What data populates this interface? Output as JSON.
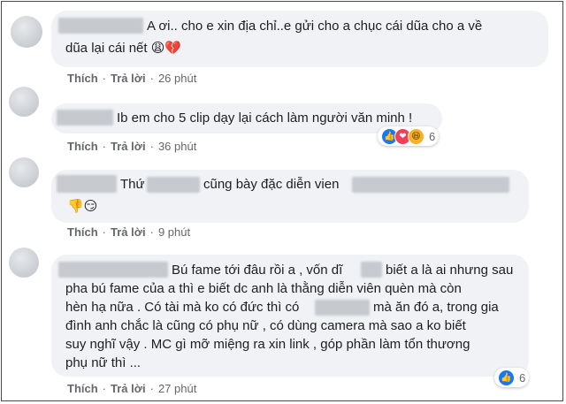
{
  "comments": [
    {
      "text": "A ơi.. cho e xin địa chỉ..e gửi cho a chục cái dũa cho a về",
      "text2": "dũa lại cái nết",
      "emoji_suffix": "😩💔",
      "like_label": "Thích",
      "reply_label": "Trả lời",
      "time": "26 phút"
    },
    {
      "text": "Ib em cho 5 clip dạy lại cách làm người văn minh !",
      "like_label": "Thích",
      "reply_label": "Trả lời",
      "time": "36 phút",
      "reactions": [
        "like",
        "love",
        "haha"
      ],
      "reaction_count": "6"
    },
    {
      "text_a": "Thứ",
      "text_b": "cũng bày đặc diễn vien",
      "emoji_line": "👎😏",
      "like_label": "Thích",
      "reply_label": "Trả lời",
      "time": "9 phút"
    },
    {
      "line1_a": "Bú fame tới đâu rồi a , vốn dĩ",
      "line1_b": "biết a là ai nhưng sau",
      "line2": "pha bú fame của a thì e biết dc anh là thằng diễn viên quèn mà còn",
      "line3": "hèn hạ nữa . Có tài mà ko có đức thì có",
      "line3_b": "mà ăn đó a, trong gia",
      "line4": "đình anh chắc là cũng có phụ nữ , có dùng camera mà sao a ko biết",
      "line5": "suy nghĩ vậy . MC gì mỡ miệng ra xin link , góp phần làm tổn thương",
      "line6": "phụ nữ thì ...",
      "like_label": "Thích",
      "reply_label": "Trả lời",
      "time": "27 phút",
      "reactions": [
        "like"
      ],
      "reaction_count": "6"
    }
  ],
  "colors": {
    "bubble": "#f0f2f5",
    "meta_text": "#65676b",
    "like": "#1877f2",
    "love": "#f33e58",
    "haha": "#f7b125"
  }
}
